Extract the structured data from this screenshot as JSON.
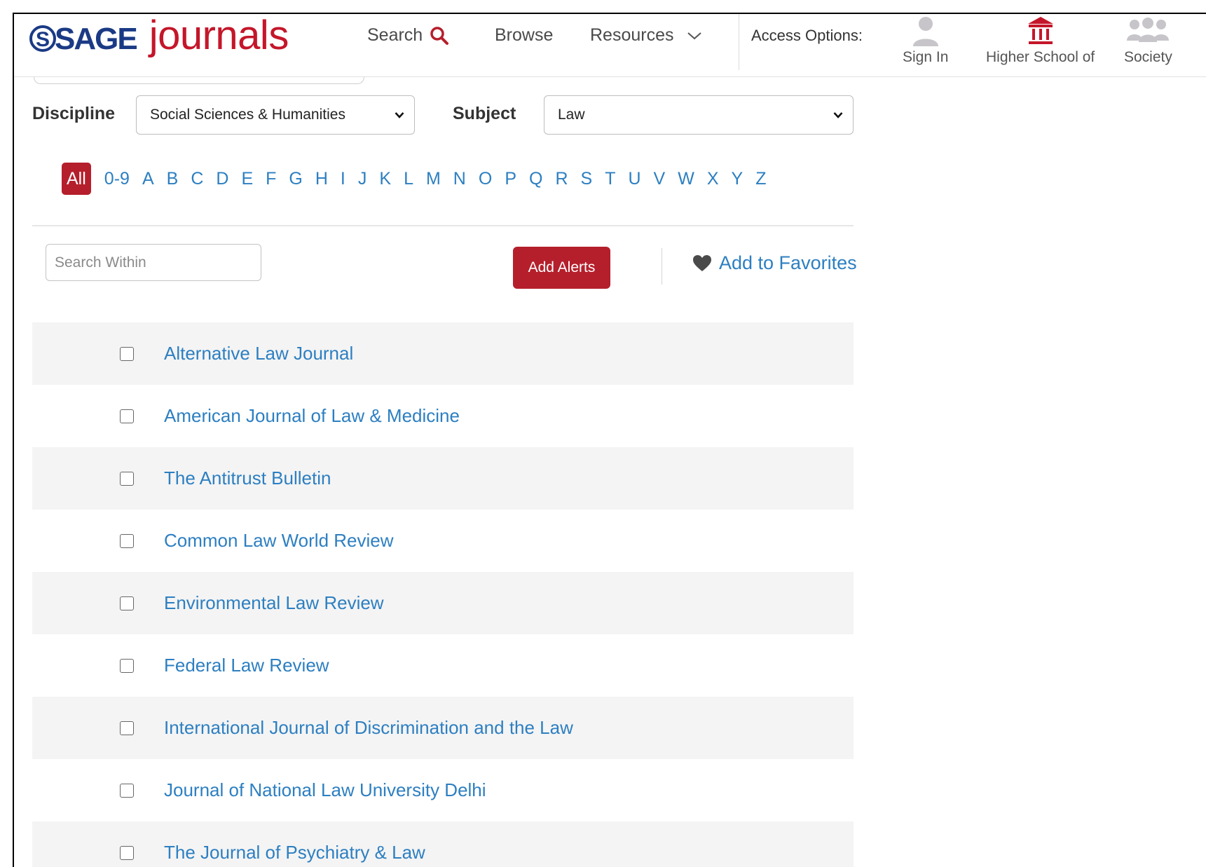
{
  "header": {
    "logo_sage": "SAGE",
    "logo_journals": "journals",
    "nav": {
      "search": "Search",
      "browse": "Browse",
      "resources": "Resources"
    },
    "access_label": "Access Options:",
    "access_options": {
      "sign_in": "Sign In",
      "institution": "Higher School of",
      "society": "Society"
    }
  },
  "filters": {
    "discipline_label": "Discipline",
    "discipline_value": "Social Sciences & Humanities",
    "subject_label": "Subject",
    "subject_value": "Law"
  },
  "alphabet": [
    "All",
    "0-9",
    "A",
    "B",
    "C",
    "D",
    "E",
    "F",
    "G",
    "H",
    "I",
    "J",
    "K",
    "L",
    "M",
    "N",
    "O",
    "P",
    "Q",
    "R",
    "S",
    "T",
    "U",
    "V",
    "W",
    "X",
    "Y",
    "Z"
  ],
  "alphabet_selected": "All",
  "toolbar": {
    "search_placeholder": "Search Within",
    "add_alerts": "Add Alerts",
    "add_favorites": "Add to Favorites"
  },
  "journals": [
    "Alternative Law Journal",
    "American Journal of Law & Medicine",
    "The Antitrust Bulletin",
    "Common Law World Review",
    "Environmental Law Review",
    "Federal Law Review",
    "International Journal of Discrimination and the Law",
    "Journal of National Law University Delhi",
    "The Journal of Psychiatry & Law"
  ],
  "colors": {
    "brand_red": "#b51f2b",
    "logo_blue": "#1a3a85",
    "link_blue": "#2d7fc1",
    "row_stripe": "#f4f4f4",
    "icon_gray": "#c7c5c9"
  },
  "icons": {
    "search": "search-icon",
    "resources_chevron": "chevron-down-icon",
    "sign_in": "user-icon",
    "institution": "institution-icon",
    "society": "group-icon",
    "favorites": "heart-icon"
  }
}
